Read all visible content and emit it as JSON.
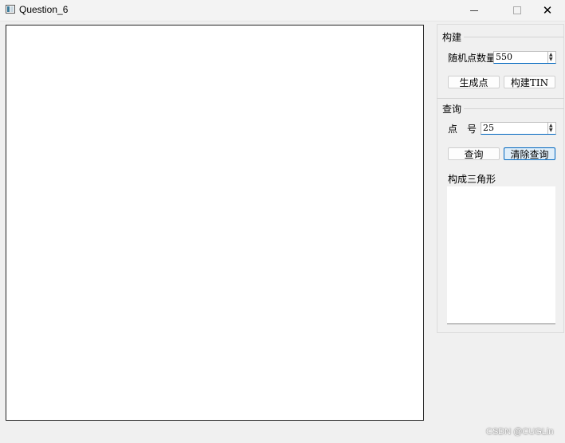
{
  "window": {
    "title": "Question_6",
    "close_glyph": "✕"
  },
  "build": {
    "title": "构建",
    "random_count_label": "随机点数量",
    "random_count_value": "550",
    "generate_points_label": "生成点",
    "build_tin_label": "构建TIN"
  },
  "query": {
    "title": "查询",
    "point_label": "点　号",
    "point_value": "25",
    "query_label": "查询",
    "clear_query_label": "清除查询",
    "triangles_label": "构成三角形"
  },
  "spin_glyphs": {
    "up": "▲",
    "down": "▼"
  },
  "watermark": "CSDN @CUGLin"
}
